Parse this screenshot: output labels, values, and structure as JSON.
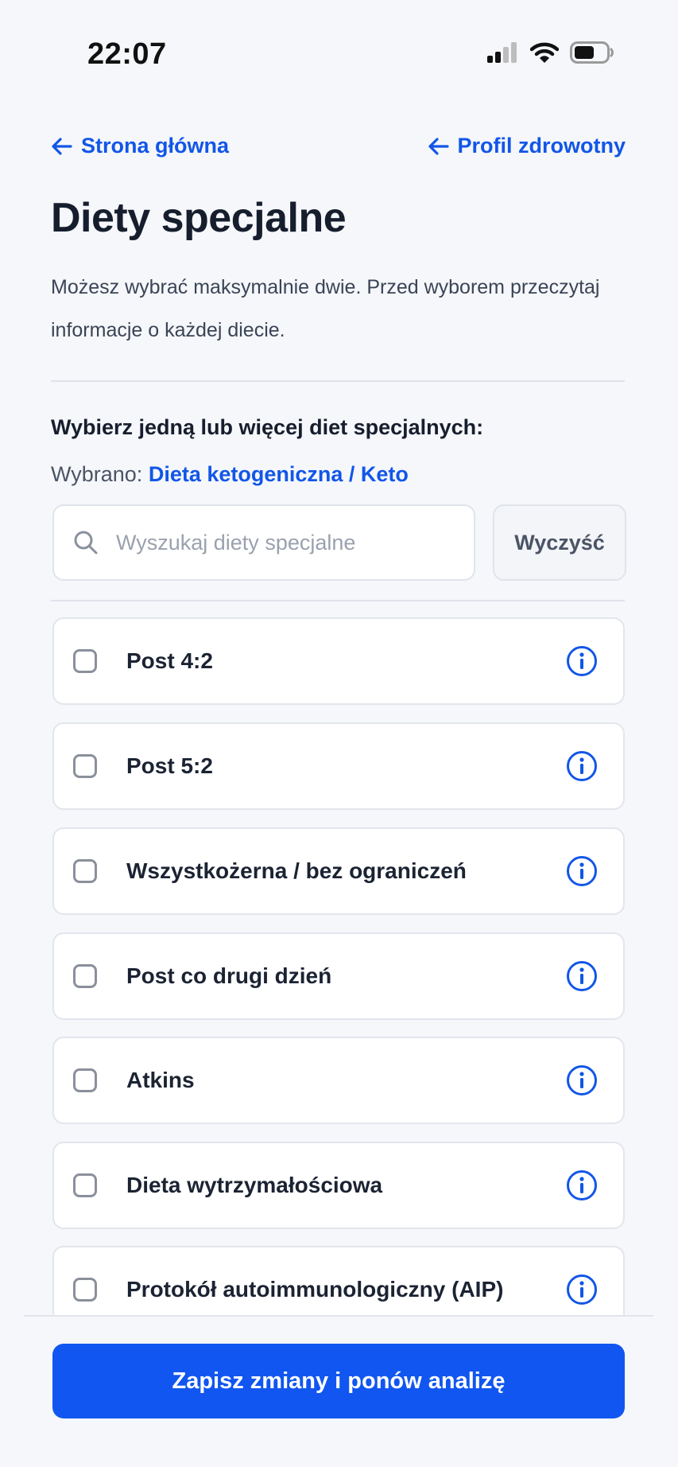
{
  "status_bar": {
    "time": "22:07",
    "icons": [
      "signal-icon",
      "wifi-icon",
      "battery-icon"
    ]
  },
  "nav": {
    "back_home": "Strona główna",
    "back_profile": "Profil zdrowotny"
  },
  "page": {
    "title": "Diety specjalne",
    "description": "Możesz wybrać maksymalnie dwie. Przed wyborem przeczytaj informacje o każdej diecie."
  },
  "selection": {
    "heading": "Wybierz jedną lub więcej diet specjalnych:",
    "selected_prefix": "Wybrano:",
    "selected_value": "Dieta ketogeniczna / Keto"
  },
  "search": {
    "placeholder": "Wyszukaj diety specjalne",
    "value": "",
    "clear_label": "Wyczyść"
  },
  "diets": [
    {
      "label": "Post 4:2",
      "checked": false
    },
    {
      "label": "Post 5:2",
      "checked": false
    },
    {
      "label": "Wszystkożerna / bez ograniczeń",
      "checked": false
    },
    {
      "label": "Post co drugi dzień",
      "checked": false
    },
    {
      "label": "Atkins",
      "checked": false
    },
    {
      "label": "Dieta wytrzymałościowa",
      "checked": false
    },
    {
      "label": "Protokół autoimmunologiczny (AIP)",
      "checked": false
    }
  ],
  "footer": {
    "save_label": "Zapisz zmiany i ponów analizę"
  },
  "colors": {
    "accent": "#1256e8",
    "button": "#1156f0",
    "background": "#f5f7fa"
  }
}
